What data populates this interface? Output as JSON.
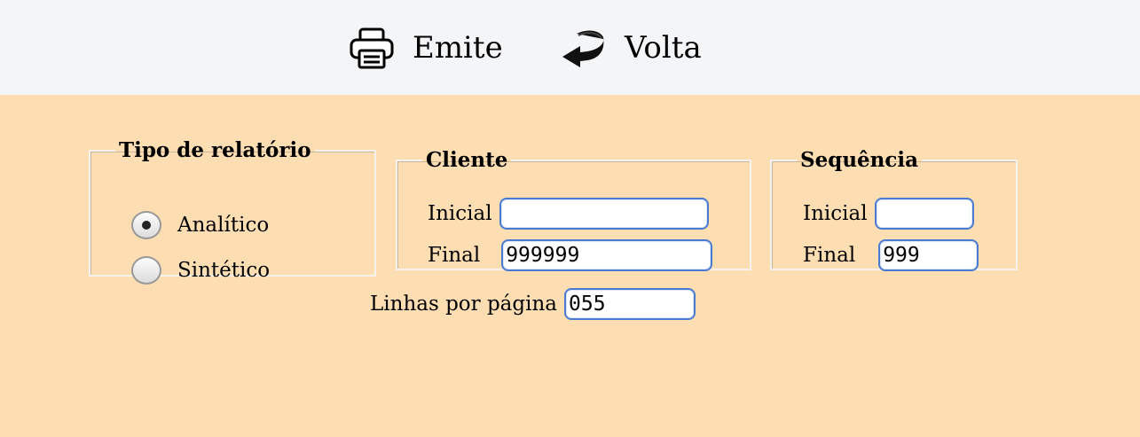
{
  "toolbar": {
    "emite": {
      "label": "Emite",
      "icon": "printer-icon"
    },
    "volta": {
      "label": "Volta",
      "icon": "return-arrow-icon"
    }
  },
  "tipo_relatorio": {
    "legend": "Tipo de relatório",
    "options": [
      {
        "label": "Analítico",
        "selected": true
      },
      {
        "label": "Sintético",
        "selected": false
      }
    ]
  },
  "cliente": {
    "legend": "Cliente",
    "inicial_label": "Inicial",
    "inicial_value": "",
    "final_label": "Final",
    "final_value": "999999"
  },
  "sequencia": {
    "legend": "Sequência",
    "inicial_label": "Inicial",
    "inicial_value": "",
    "final_label": "Final",
    "final_value": "999"
  },
  "linhas": {
    "label": "Linhas por página",
    "value": "055"
  },
  "colors": {
    "toolbar_bg": "#f4f5f7",
    "content_bg": "#fddeb3",
    "input_border": "#4a7bd1"
  }
}
